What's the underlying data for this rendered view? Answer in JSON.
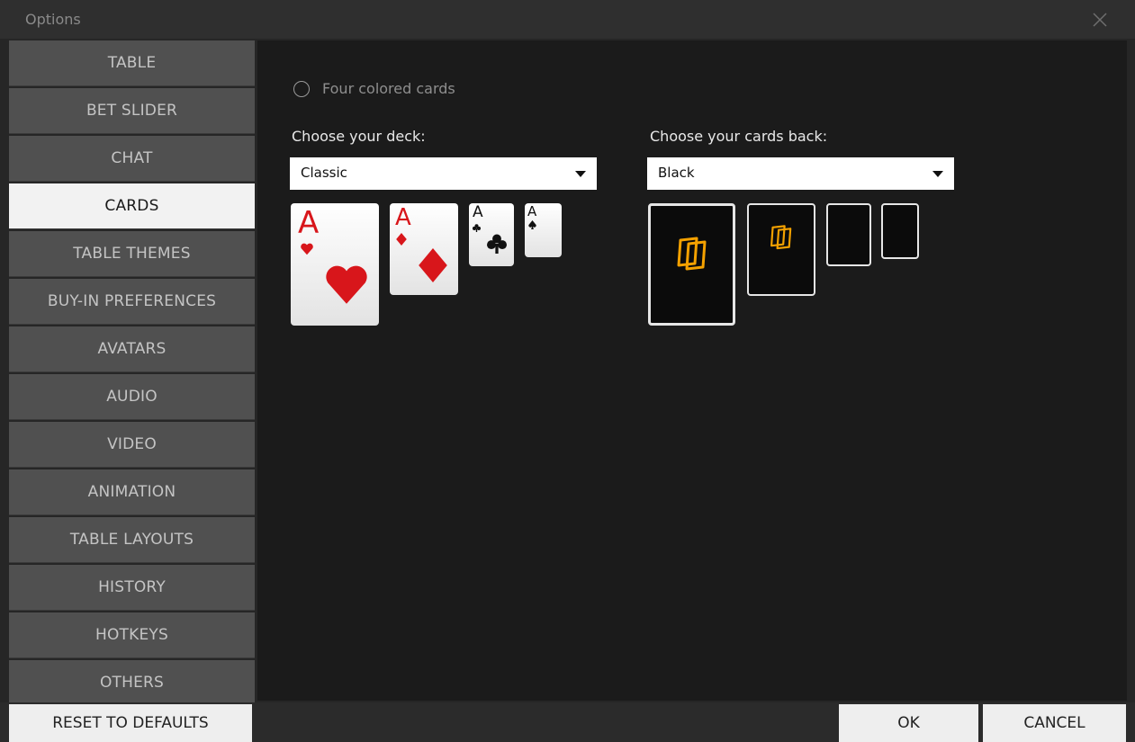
{
  "window": {
    "title": "Options"
  },
  "sidebar": {
    "items": [
      {
        "label": "TABLE"
      },
      {
        "label": "BET SLIDER"
      },
      {
        "label": "CHAT"
      },
      {
        "label": "CARDS"
      },
      {
        "label": "TABLE THEMES"
      },
      {
        "label": "BUY-IN PREFERENCES"
      },
      {
        "label": "AVATARS"
      },
      {
        "label": "AUDIO"
      },
      {
        "label": "VIDEO"
      },
      {
        "label": "ANIMATION"
      },
      {
        "label": "TABLE LAYOUTS"
      },
      {
        "label": "HISTORY"
      },
      {
        "label": "HOTKEYS"
      },
      {
        "label": "OTHERS"
      }
    ],
    "active_label": "CARDS"
  },
  "cards": {
    "four_color_label": "Four colored cards",
    "four_color_checked": false,
    "deck_label": "Choose your deck:",
    "deck_value": "Classic",
    "back_label": "Choose your cards back:",
    "back_value": "Black",
    "deck_previews": [
      {
        "rank": "A",
        "suit": "hearts",
        "color": "#d8161b"
      },
      {
        "rank": "A",
        "suit": "diamonds",
        "color": "#d8161b"
      },
      {
        "rank": "A",
        "suit": "clubs",
        "color": "#111111"
      },
      {
        "rank": "A",
        "suit": "spades",
        "color": "#111111"
      }
    ],
    "back_previews": [
      {
        "logo": true,
        "selected": true
      },
      {
        "logo": true,
        "selected": false
      },
      {
        "logo": false,
        "selected": false
      },
      {
        "logo": false,
        "selected": false
      }
    ],
    "logo_color": "#f4a100"
  },
  "footer": {
    "reset_label": "RESET TO DEFAULTS",
    "ok_label": "OK",
    "cancel_label": "CANCEL"
  }
}
